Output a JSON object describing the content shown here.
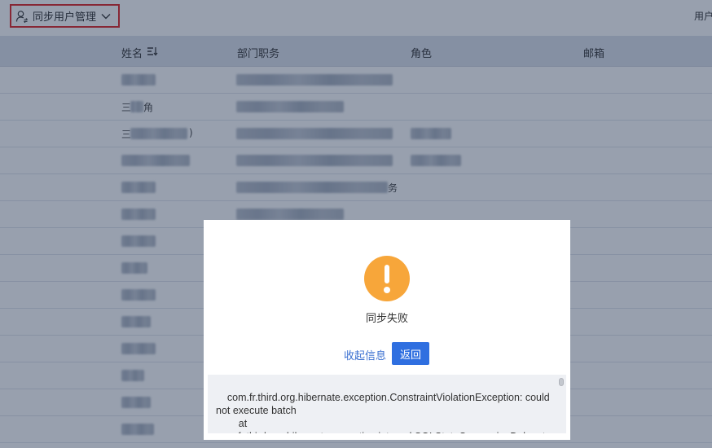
{
  "topbar": {
    "menu_label": "同步用户管理",
    "right_label": "用户"
  },
  "table": {
    "columns": [
      "姓名",
      "部门职务",
      "角色",
      "邮箱"
    ],
    "visible_cell_fragments": {
      "row2_name": "三",
      "row2_name_tail": "角",
      "row3_name": "三",
      "row3_name_tail": ")",
      "row5_dept_tail": "务"
    }
  },
  "dialog": {
    "title": "同步失败",
    "collapse_label": "收起信息",
    "back_label": "返回",
    "error_text": "com.fr.third.org.hibernate.exception.ConstraintViolationException: could not execute batch\n        at\ncom.fr.third.org.hibernate.exception.internal.SQLStateConversionDelegate.",
    "icon": "warning-icon",
    "icon_color": "#f7a63a",
    "button_color": "#2f6fe0"
  }
}
